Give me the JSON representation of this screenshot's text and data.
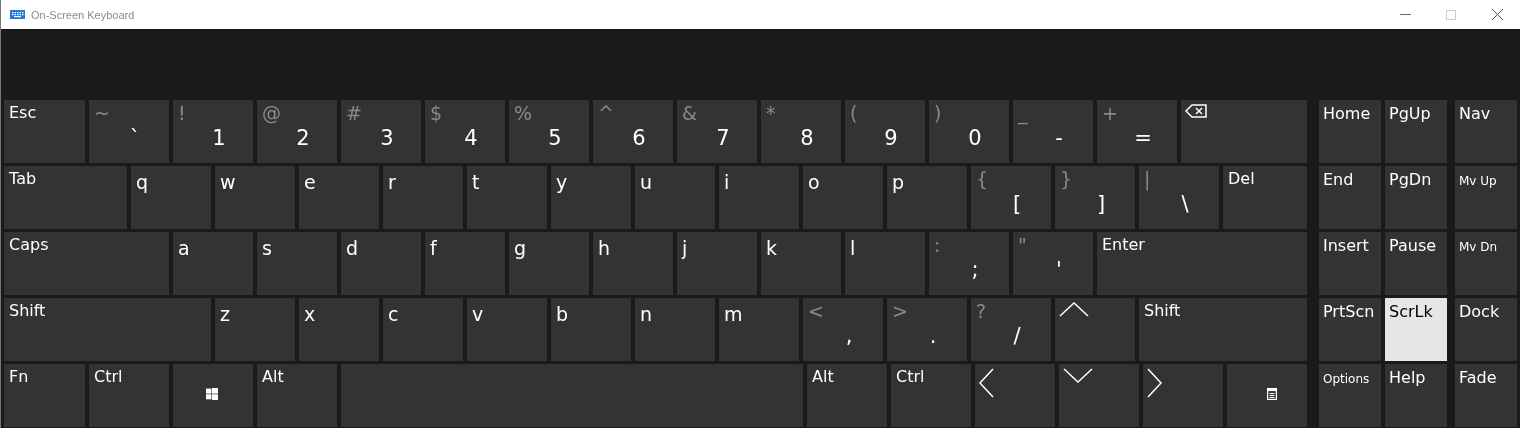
{
  "window": {
    "title": "On-Screen Keyboard"
  },
  "rows": [
    [
      {
        "kind": "label",
        "label": "Esc"
      },
      {
        "kind": "symbol",
        "shift": "~",
        "label": "`"
      },
      {
        "kind": "symbol",
        "shift": "!",
        "label": "1"
      },
      {
        "kind": "symbol",
        "shift": "@",
        "label": "2"
      },
      {
        "kind": "symbol",
        "shift": "#",
        "label": "3"
      },
      {
        "kind": "symbol",
        "shift": "$",
        "label": "4"
      },
      {
        "kind": "symbol",
        "shift": "%",
        "label": "5"
      },
      {
        "kind": "symbol",
        "shift": "^",
        "label": "6"
      },
      {
        "kind": "symbol",
        "shift": "&",
        "label": "7"
      },
      {
        "kind": "symbol",
        "shift": "*",
        "label": "8"
      },
      {
        "kind": "symbol",
        "shift": "(",
        "label": "9"
      },
      {
        "kind": "symbol",
        "shift": ")",
        "label": "0"
      },
      {
        "kind": "symbol",
        "shift": "_",
        "label": "-"
      },
      {
        "kind": "symbol",
        "shift": "+",
        "label": "="
      },
      {
        "kind": "backspace"
      }
    ],
    [
      {
        "kind": "label",
        "label": "Tab"
      },
      {
        "kind": "letter",
        "label": "q"
      },
      {
        "kind": "letter",
        "label": "w"
      },
      {
        "kind": "letter",
        "label": "e"
      },
      {
        "kind": "letter",
        "label": "r"
      },
      {
        "kind": "letter",
        "label": "t"
      },
      {
        "kind": "letter",
        "label": "y"
      },
      {
        "kind": "letter",
        "label": "u"
      },
      {
        "kind": "letter",
        "label": "i"
      },
      {
        "kind": "letter",
        "label": "o"
      },
      {
        "kind": "letter",
        "label": "p"
      },
      {
        "kind": "symbol",
        "shift": "{",
        "label": "["
      },
      {
        "kind": "symbol",
        "shift": "}",
        "label": "]"
      },
      {
        "kind": "symbol",
        "shift": "|",
        "label": "\\"
      },
      {
        "kind": "label",
        "label": "Del"
      }
    ],
    [
      {
        "kind": "label",
        "label": "Caps"
      },
      {
        "kind": "letter",
        "label": "a"
      },
      {
        "kind": "letter",
        "label": "s"
      },
      {
        "kind": "letter",
        "label": "d"
      },
      {
        "kind": "letter",
        "label": "f"
      },
      {
        "kind": "letter",
        "label": "g"
      },
      {
        "kind": "letter",
        "label": "h"
      },
      {
        "kind": "letter",
        "label": "j"
      },
      {
        "kind": "letter",
        "label": "k"
      },
      {
        "kind": "letter",
        "label": "l"
      },
      {
        "kind": "symbol",
        "shift": ":",
        "label": ";"
      },
      {
        "kind": "symbol",
        "shift": "\"",
        "label": "'"
      },
      {
        "kind": "label",
        "label": "Enter"
      }
    ],
    [
      {
        "kind": "label",
        "label": "Shift"
      },
      {
        "kind": "letter",
        "label": "z"
      },
      {
        "kind": "letter",
        "label": "x"
      },
      {
        "kind": "letter",
        "label": "c"
      },
      {
        "kind": "letter",
        "label": "v"
      },
      {
        "kind": "letter",
        "label": "b"
      },
      {
        "kind": "letter",
        "label": "n"
      },
      {
        "kind": "letter",
        "label": "m"
      },
      {
        "kind": "symbol",
        "shift": "<",
        "label": ","
      },
      {
        "kind": "symbol",
        "shift": ">",
        "label": "."
      },
      {
        "kind": "symbol",
        "shift": "?",
        "label": "/"
      },
      {
        "kind": "up"
      },
      {
        "kind": "label",
        "label": "Shift"
      }
    ],
    [
      {
        "kind": "label",
        "label": "Fn"
      },
      {
        "kind": "label",
        "label": "Ctrl"
      },
      {
        "kind": "windows"
      },
      {
        "kind": "label",
        "label": "Alt"
      },
      {
        "kind": "space"
      },
      {
        "kind": "label",
        "label": "Alt"
      },
      {
        "kind": "label",
        "label": "Ctrl"
      },
      {
        "kind": "left"
      },
      {
        "kind": "down"
      },
      {
        "kind": "right"
      },
      {
        "kind": "menu"
      }
    ]
  ],
  "side_keys": [
    {
      "kind": "label",
      "label": "Home",
      "on": false
    },
    {
      "kind": "label",
      "label": "PgUp",
      "on": false
    },
    {
      "kind": "label",
      "label": "Nav",
      "on": false
    },
    {
      "kind": "label",
      "label": "End",
      "on": false
    },
    {
      "kind": "label",
      "label": "PgDn",
      "on": false
    },
    {
      "kind": "small",
      "label": "Mv Up",
      "on": false
    },
    {
      "kind": "label",
      "label": "Insert",
      "on": false
    },
    {
      "kind": "label",
      "label": "Pause",
      "on": false
    },
    {
      "kind": "small",
      "label": "Mv Dn",
      "on": false
    },
    {
      "kind": "label",
      "label": "PrtScn",
      "on": false
    },
    {
      "kind": "label",
      "label": "ScrLk",
      "on": true
    },
    {
      "kind": "label",
      "label": "Dock",
      "on": false
    },
    {
      "kind": "small",
      "label": "Options",
      "on": false
    },
    {
      "kind": "label",
      "label": "Help",
      "on": false
    },
    {
      "kind": "label",
      "label": "Fade",
      "on": false
    }
  ]
}
